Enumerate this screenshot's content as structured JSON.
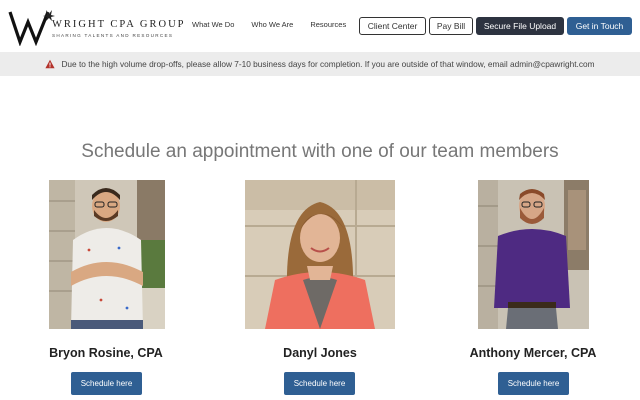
{
  "logo": {
    "name": "WRIGHT CPA GROUP",
    "tagline": "SHARING TALENTS AND RESOURCES"
  },
  "nav": {
    "items": [
      "What We Do",
      "Who We Are",
      "Resources"
    ]
  },
  "header_buttons": {
    "client_center": "Client Center",
    "pay_bill": "Pay Bill",
    "secure_upload": "Secure File Upload",
    "get_in_touch": "Get in Touch"
  },
  "alert": {
    "icon": "warning-icon",
    "text": "Due to the high volume drop-offs, please allow 7-10 business days for completion. If you are outside of that window, email admin@cpawright.com"
  },
  "main": {
    "heading": "Schedule an appointment with one of our team members",
    "team": [
      {
        "name": "Bryon Rosine, CPA",
        "button": "Schedule here"
      },
      {
        "name": "Danyl Jones",
        "button": "Schedule here"
      },
      {
        "name": "Anthony Mercer, CPA",
        "button": "Schedule here"
      }
    ]
  },
  "colors": {
    "accent_blue": "#2f5f93",
    "dark_button": "#2d3340",
    "alert_bg": "#ececec",
    "alert_icon": "#b3322b"
  }
}
